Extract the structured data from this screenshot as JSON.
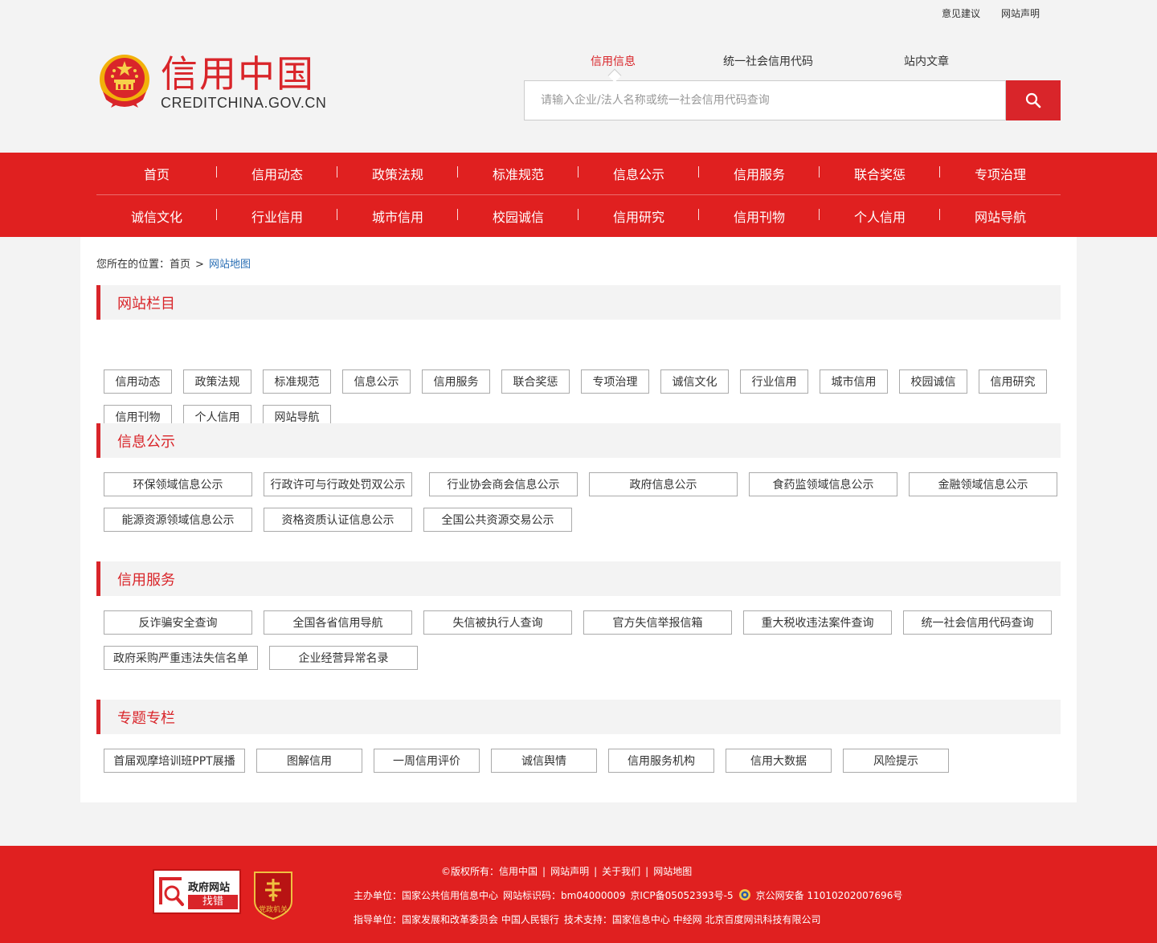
{
  "toplinks": {
    "feedback": "意见建议",
    "statement": "网站声明"
  },
  "logo": {
    "cn": "信用中国",
    "en": "CREDITCHINA.GOV.CN"
  },
  "search": {
    "tabs": [
      "信用信息",
      "统一社会信用代码",
      "站内文章"
    ],
    "active_tab": "信用信息",
    "placeholder": "请输入企业/法人名称或统一社会信用代码查询"
  },
  "nav": {
    "row1": [
      "首页",
      "信用动态",
      "政策法规",
      "标准规范",
      "信息公示",
      "信用服务",
      "联合奖惩",
      "专项治理"
    ],
    "row2": [
      "诚信文化",
      "行业信用",
      "城市信用",
      "校园诚信",
      "信用研究",
      "信用刊物",
      "个人信用",
      "网站导航"
    ]
  },
  "breadcrumb": {
    "label": "您所在的位置：",
    "home": "首页",
    "sep": ">",
    "current": "网站地图"
  },
  "sections": [
    {
      "title": "网站栏目",
      "tags": [
        "信用动态",
        "政策法规",
        "标准规范",
        "信息公示",
        "信用服务",
        "联合奖惩",
        "专项治理",
        "诚信文化",
        "行业信用",
        "城市信用",
        "校园诚信",
        "信用研究",
        "信用刊物",
        "个人信用",
        "网站导航"
      ]
    },
    {
      "title": "信息公示",
      "tags": [
        "环保领域信息公示",
        "行政许可与行政处罚双公示",
        "行业协会商会信息公示",
        "政府信息公示",
        "食药监领域信息公示",
        "金融领域信息公示",
        "能源资源领域信息公示",
        "资格资质认证信息公示",
        "全国公共资源交易公示"
      ]
    },
    {
      "title": "信用服务",
      "tags": [
        "反诈骗安全查询",
        "全国各省信用导航",
        "失信被执行人查询",
        "官方失信举报信箱",
        "重大税收违法案件查询",
        "统一社会信用代码查询",
        "政府采购严重违法失信名单",
        "企业经营异常名录"
      ]
    },
    {
      "title": "专题专栏",
      "tags": [
        "首届观摩培训班PPT展播",
        "图解信用",
        "一周信用评价",
        "诚信舆情",
        "信用服务机构",
        "信用大数据",
        "风险提示"
      ]
    }
  ],
  "footer": {
    "copyright_label": "©版权所有：",
    "copyright_links": [
      "信用中国",
      "网站声明",
      "关于我们",
      "网站地图"
    ],
    "host_label": "主办单位：",
    "host": "国家公共信用信息中心",
    "site_id": "网站标识码：bm04000009",
    "icp": "京ICP备05052393号-5",
    "police": "京公网安备 11010202007696号",
    "guide_label": "指导单位：",
    "guide": "国家发展和改革委员会  中国人民银行",
    "tech": "技术支持：国家信息中心  中经网  北京百度网讯科技有限公司",
    "gov_badge_top": "政府网站",
    "gov_badge_bottom": "找错",
    "party_badge": "党政机关"
  },
  "colors": {
    "brand_red": "#d9252a",
    "nav_red": "#e02020",
    "link_blue": "#2a6fb5"
  }
}
